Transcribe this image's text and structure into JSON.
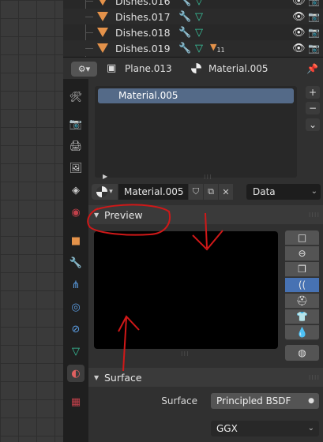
{
  "outliner": {
    "rows": [
      {
        "name": "Dishes.016"
      },
      {
        "name": "Dishes.017"
      },
      {
        "name": "Dishes.018"
      },
      {
        "name": "Dishes.019",
        "material_count": "11"
      }
    ],
    "icons": [
      "wrench-icon",
      "mesh-data-icon",
      "eye-icon",
      "camera-icon"
    ]
  },
  "header": {
    "object_name": "Plane.013",
    "material_name": "Material.005"
  },
  "material_slots": {
    "items": [
      "Material.005"
    ],
    "add_label": "+",
    "remove_label": "−",
    "more_label": "⌄"
  },
  "material": {
    "name": "Material.005",
    "link": "Data"
  },
  "preview": {
    "title": "Preview",
    "shapes": [
      "flat",
      "sphere",
      "cube",
      "hair",
      "shader-ball",
      "cloth",
      "fluid"
    ],
    "active_shape": "hair"
  },
  "surface": {
    "title": "Surface",
    "label": "Surface",
    "shader": "Principled BSDF",
    "distribution": "GGX"
  },
  "colors": {
    "accent": "#4772b3",
    "selection": "#546a88",
    "object_orange": "#e4924a",
    "mesh_green": "#39c9a0",
    "annotation_red": "#d01818"
  }
}
